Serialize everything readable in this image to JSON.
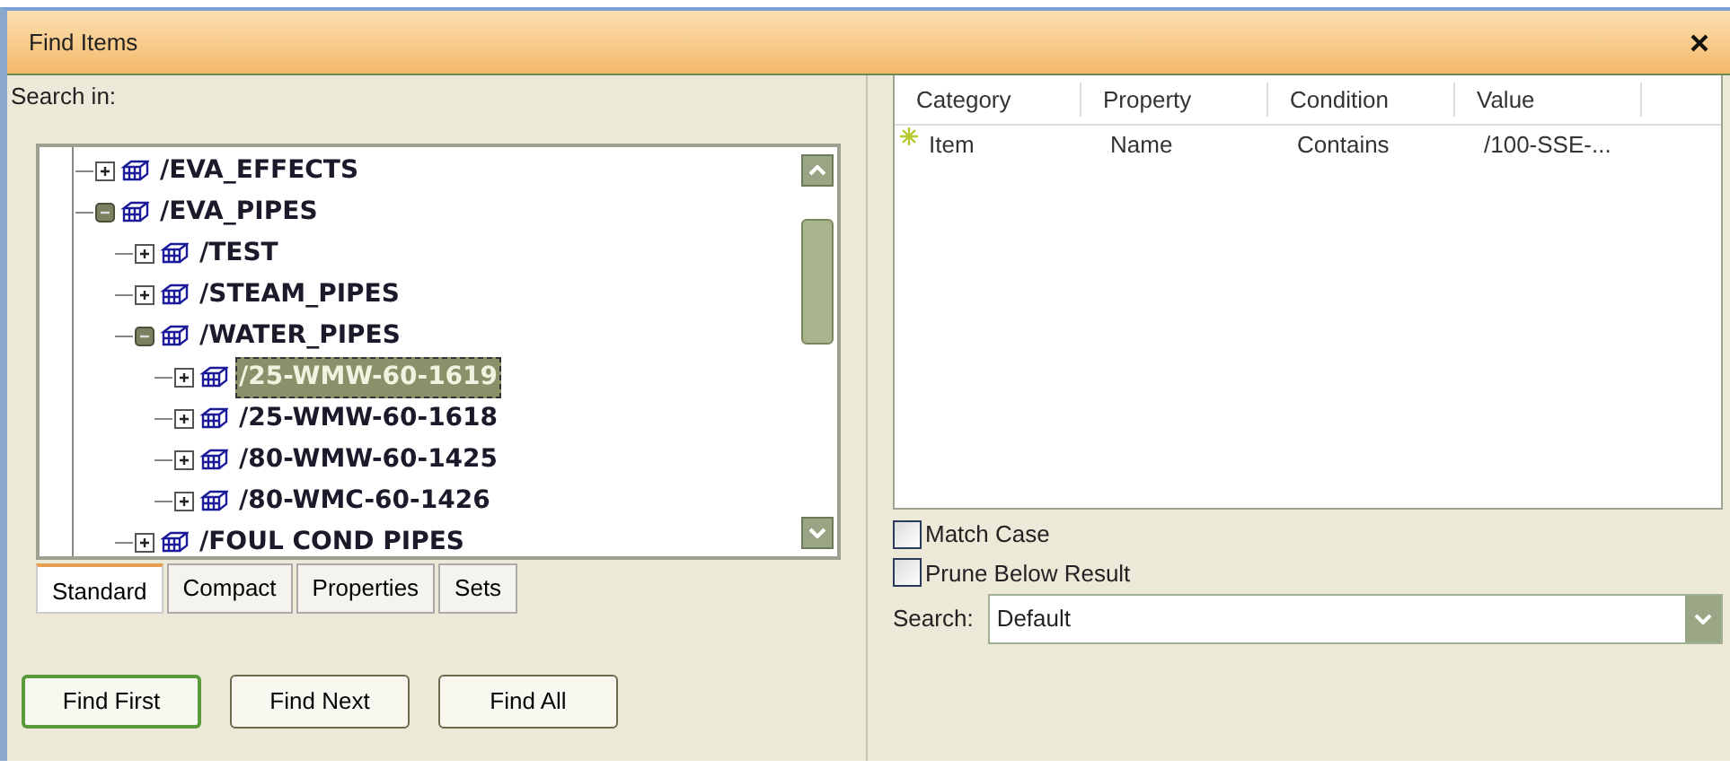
{
  "window": {
    "title": "Find Items"
  },
  "search_in_label": "Search in:",
  "tree": [
    {
      "label": "/EVA_EFFECTS",
      "expanded": false,
      "selected": false
    },
    {
      "label": "/EVA_PIPES",
      "expanded": true,
      "selected": false,
      "children": [
        {
          "label": "/TEST",
          "expanded": false,
          "selected": false
        },
        {
          "label": "/STEAM_PIPES",
          "expanded": false,
          "selected": false
        },
        {
          "label": "/WATER_PIPES",
          "expanded": true,
          "selected": false,
          "children": [
            {
              "label": "/25-WMW-60-1619",
              "expanded": false,
              "selected": true
            },
            {
              "label": "/25-WMW-60-1618",
              "expanded": false,
              "selected": false
            },
            {
              "label": "/80-WMW-60-1425",
              "expanded": false,
              "selected": false
            },
            {
              "label": "/80-WMC-60-1426",
              "expanded": false,
              "selected": false
            }
          ]
        },
        {
          "label": "/FOUL COND PIPES",
          "expanded": false,
          "selected": false
        }
      ]
    }
  ],
  "tabs": [
    {
      "label": "Standard",
      "selected": true
    },
    {
      "label": "Compact",
      "selected": false
    },
    {
      "label": "Properties",
      "selected": false
    },
    {
      "label": "Sets",
      "selected": false
    }
  ],
  "buttons": [
    {
      "label": "Find First",
      "selected": true
    },
    {
      "label": "Find Next",
      "selected": false
    },
    {
      "label": "Find All",
      "selected": false
    }
  ],
  "table": {
    "columns": [
      "Category",
      "Property",
      "Condition",
      "Value"
    ],
    "rows": [
      {
        "cells": [
          "Item",
          "Name",
          "Contains",
          "/100-SSE-..."
        ]
      }
    ]
  },
  "options": [
    {
      "label": "Match Case",
      "checked": false
    },
    {
      "label": "Prune Below Result",
      "checked": false
    }
  ],
  "search": {
    "label": "Search:",
    "value": "Default"
  }
}
